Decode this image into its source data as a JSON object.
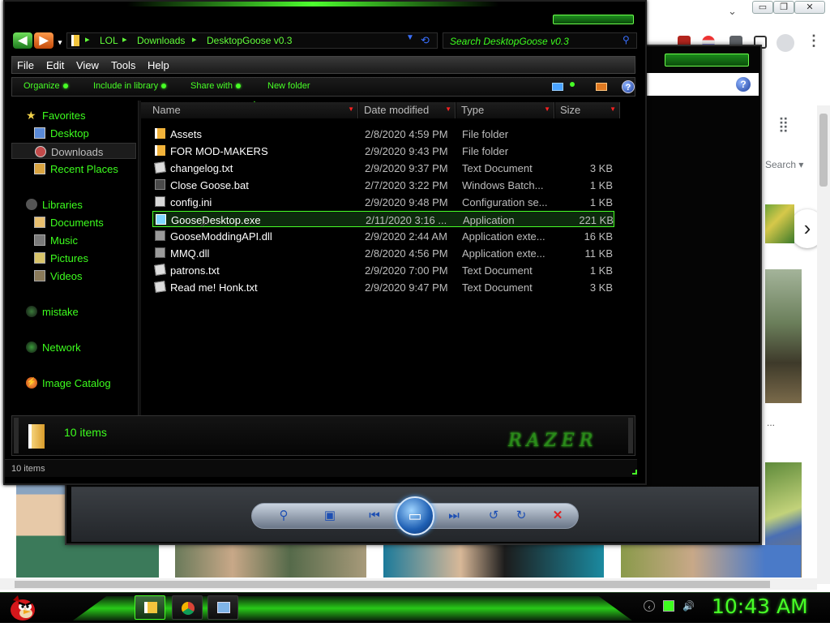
{
  "browser": {
    "tab_dropdown_icon": "chevron-down-icon",
    "window_buttons": [
      "minimize",
      "restore",
      "close"
    ],
    "apps_icon": "grid-icon",
    "search_label": "Search",
    "next_icon": "chevron-right-icon",
    "dots": "..."
  },
  "viewer": {
    "help_label": "?",
    "controls": [
      {
        "icon": "zoom-icon",
        "glyph": "⚲"
      },
      {
        "icon": "actual-size-icon",
        "glyph": "▣"
      },
      {
        "icon": "previous-icon",
        "glyph": "⏮"
      },
      {
        "icon": "slideshow-icon",
        "glyph": "▭"
      },
      {
        "icon": "next-icon",
        "glyph": "⏭"
      },
      {
        "icon": "rotate-left-icon",
        "glyph": "↺"
      },
      {
        "icon": "rotate-right-icon",
        "glyph": "↻"
      },
      {
        "icon": "delete-icon",
        "glyph": "✕"
      }
    ]
  },
  "explorer": {
    "address": {
      "crumbs": [
        "LOL",
        "Downloads",
        "DesktopGoose v0.3"
      ],
      "arrow_glyph": "▸"
    },
    "search": {
      "placeholder": "Search DesktopGoose v0.3"
    },
    "menu": [
      "File",
      "Edit",
      "View",
      "Tools",
      "Help"
    ],
    "commands": [
      "Organize",
      "Include in library",
      "Share with",
      "New folder"
    ],
    "help_label": "?",
    "nav": {
      "favorites": {
        "label": "Favorites",
        "items": [
          "Desktop",
          "Downloads",
          "Recent Places"
        ]
      },
      "libraries": {
        "label": "Libraries",
        "items": [
          "Documents",
          "Music",
          "Pictures",
          "Videos"
        ]
      },
      "homegroup": "mistake",
      "network": "Network",
      "image_catalog": "Image Catalog",
      "selected": "Downloads"
    },
    "columns": [
      "Name",
      "Date modified",
      "Type",
      "Size"
    ],
    "files": [
      {
        "name": "Assets",
        "date": "2/8/2020 4:59 PM",
        "type": "File folder",
        "size": "",
        "icon": "folder"
      },
      {
        "name": "FOR MOD-MAKERS",
        "date": "2/9/2020 9:43 PM",
        "type": "File folder",
        "size": "",
        "icon": "folder"
      },
      {
        "name": "changelog.txt",
        "date": "2/9/2020 9:37 PM",
        "type": "Text Document",
        "size": "3 KB",
        "icon": "text"
      },
      {
        "name": "Close Goose.bat",
        "date": "2/7/2020 3:22 PM",
        "type": "Windows Batch...",
        "size": "1 KB",
        "icon": "bat"
      },
      {
        "name": "config.ini",
        "date": "2/9/2020 9:48 PM",
        "type": "Configuration se...",
        "size": "1 KB",
        "icon": "ini"
      },
      {
        "name": "GooseDesktop.exe",
        "date": "2/11/2020 3:16 ...",
        "type": "Application",
        "size": "221 KB",
        "icon": "exe"
      },
      {
        "name": "GooseModdingAPI.dll",
        "date": "2/9/2020 2:44 AM",
        "type": "Application exte...",
        "size": "16 KB",
        "icon": "dll"
      },
      {
        "name": "MMQ.dll",
        "date": "2/8/2020 4:56 PM",
        "type": "Application exte...",
        "size": "11 KB",
        "icon": "dll"
      },
      {
        "name": "patrons.txt",
        "date": "2/9/2020 7:00 PM",
        "type": "Text Document",
        "size": "1 KB",
        "icon": "text"
      },
      {
        "name": "Read me! Honk.txt",
        "date": "2/9/2020 9:47 PM",
        "type": "Text Document",
        "size": "3 KB",
        "icon": "text"
      }
    ],
    "selected_file": "GooseDesktop.exe",
    "details": {
      "count": "10 items",
      "logo": "RAZER"
    },
    "status": {
      "count": "10 items"
    }
  },
  "taskbar": {
    "buttons": [
      {
        "name": "explorer",
        "icon": "folder-icon"
      },
      {
        "name": "chrome",
        "icon": "chrome-icon"
      },
      {
        "name": "photo-viewer",
        "icon": "photo-viewer-icon"
      }
    ],
    "tray": [
      "chevron-left-icon",
      "network-icon",
      "volume-icon"
    ],
    "clock": "10:43 AM"
  },
  "colors": {
    "accent_green": "#47ff26",
    "background": "#000000",
    "text_muted": "#bdbdbd"
  }
}
